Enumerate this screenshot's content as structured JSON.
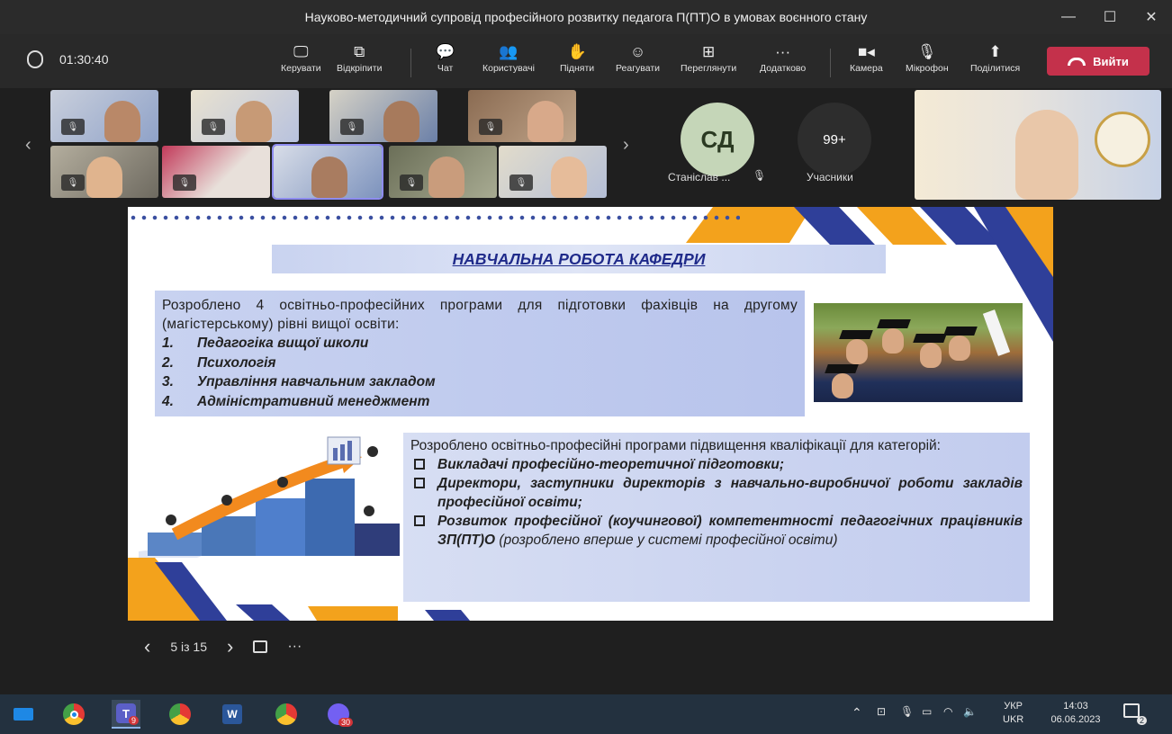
{
  "window": {
    "title": "Науково-методичний супровід професійного розвитку педагога П(ПТ)О в умовах воєнного стану",
    "controls": [
      "—",
      "☐",
      "✕"
    ]
  },
  "toolbar": {
    "timer": "01:30:40",
    "buttons": [
      {
        "label": "Керувати",
        "icon": "manage-icon",
        "glyph": "🖵"
      },
      {
        "label": "Відкріпити",
        "icon": "popout-icon",
        "glyph": "⧉"
      },
      {
        "label": "Чат",
        "icon": "chat-icon",
        "glyph": "💬"
      },
      {
        "label": "Користувачі",
        "icon": "people-icon",
        "glyph": "👥"
      },
      {
        "label": "Підняти",
        "icon": "raise-hand-icon",
        "glyph": "✋"
      },
      {
        "label": "Реагувати",
        "icon": "react-icon",
        "glyph": "☺"
      },
      {
        "label": "Переглянути",
        "icon": "view-icon",
        "glyph": "⊞"
      },
      {
        "label": "Додатково",
        "icon": "more-icon",
        "glyph": "···"
      },
      {
        "label": "Камера",
        "icon": "camera-icon",
        "glyph": "■◂"
      },
      {
        "label": "Мікрофон",
        "icon": "mic-off-icon",
        "glyph": "🎙"
      },
      {
        "label": "Поділитися",
        "icon": "share-icon",
        "glyph": "⬆"
      }
    ],
    "leave_label": "Вийти"
  },
  "gallery": {
    "avatar_initials": "СД",
    "avatar_name": "Станіслав ...",
    "participants_count": "99+",
    "participants_label": "Учасники"
  },
  "slide": {
    "title": "НАВЧАЛЬНА РОБОТА КАФЕДРИ",
    "block1_intro": "Розроблено 4 освітньо-професійних програми для підготовки фахівців на другому (магістерському) рівні вищої освіти:",
    "block1_items": [
      {
        "num": "1.",
        "text": "Педагогіка вищої школи"
      },
      {
        "num": "2.",
        "text": "Психологія"
      },
      {
        "num": "3.",
        "text": "Управління навчальним закладом"
      },
      {
        "num": "4.",
        "text": "Адміністративний менеджмент"
      }
    ],
    "block2_intro": "Розроблено освітньо-професійні програми підвищення кваліфікації для категорій:",
    "block2_item1": "Викладачі професійно-теоретичної підготовки;",
    "block2_item2": "Директори, заступники директорів з навчально-виробничої роботи закладів професійної освіти;",
    "block2_item3_bold": "Розвиток професійної (коучингової) компетентності педагогічних працівників ЗП(ПТ)О",
    "block2_item3_rest": " (розроблено вперше у системі професійної освіти)"
  },
  "slide_controls": {
    "prev": "‹",
    "page": "5 із 15",
    "next": "›",
    "more": "···"
  },
  "taskbar": {
    "lang_top": "УКР",
    "lang_bottom": "UKR",
    "time": "14:03",
    "date": "06.06.2023",
    "teams_badge": "9",
    "viber_badge": "30",
    "notif_badge": "2"
  },
  "colors": {
    "leave_red": "#c4314b",
    "slide_navy": "#1f2a8a",
    "stripe_orange": "#f3a21c",
    "stripe_blue": "#2f3f99"
  }
}
